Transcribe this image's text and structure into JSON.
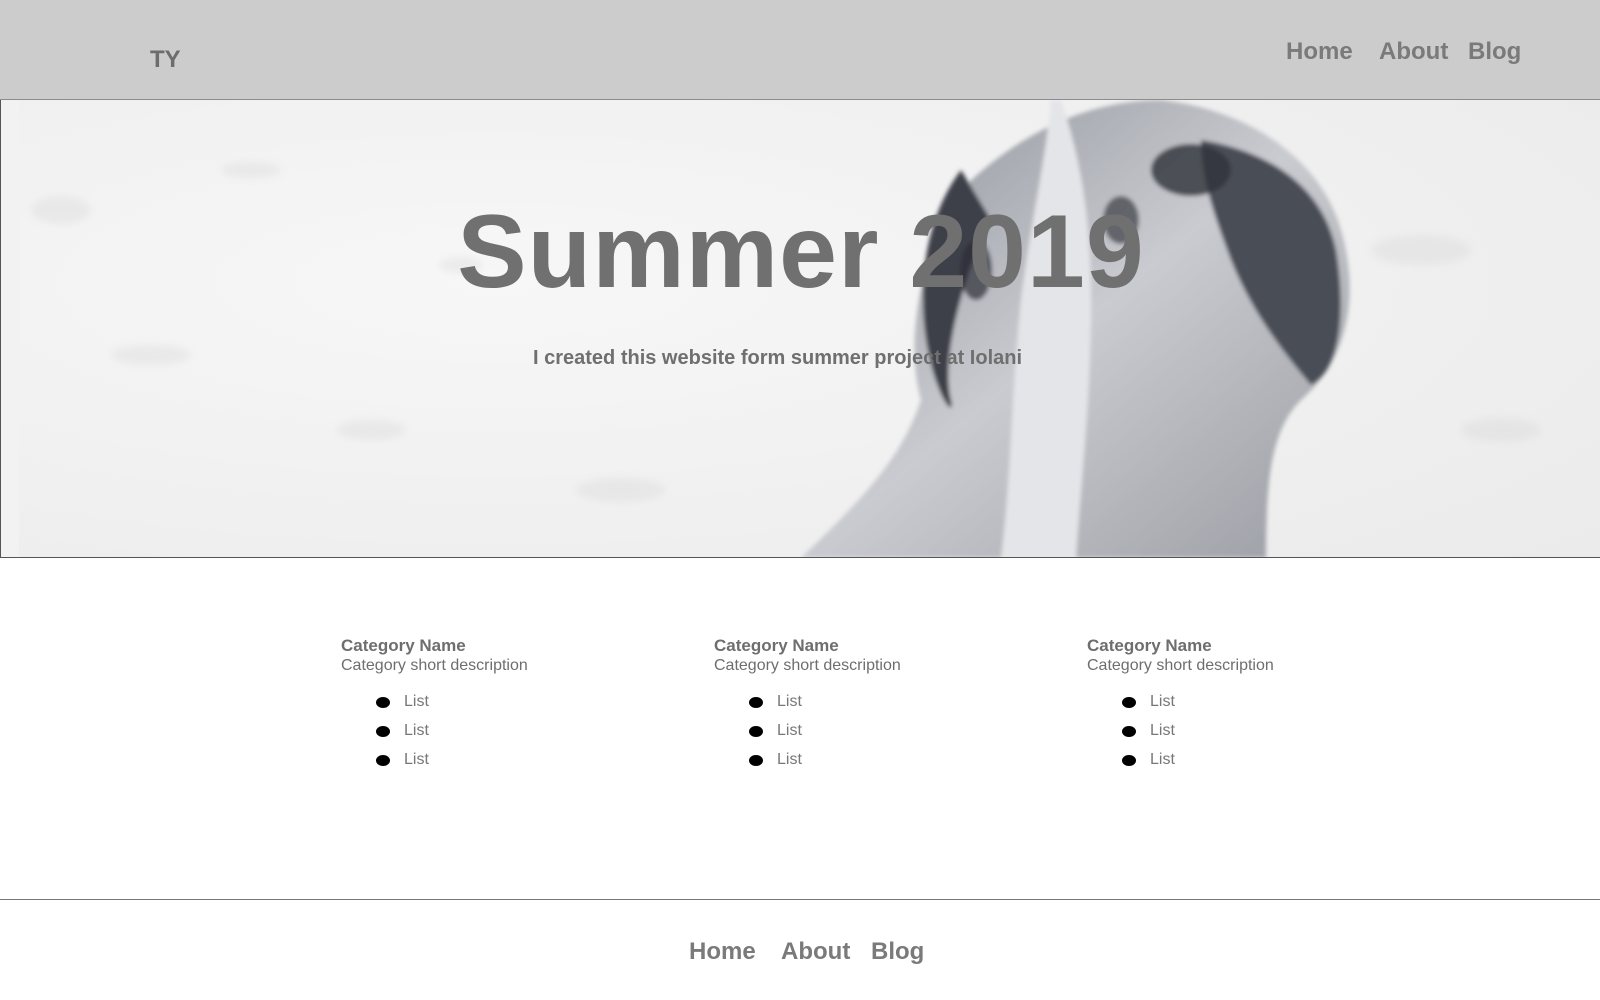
{
  "header": {
    "logo": "TY",
    "nav": [
      "Home",
      "About",
      "Blog"
    ]
  },
  "hero": {
    "title": "Summer 2019",
    "subtitle": "I created this website form summer project at Iolani"
  },
  "categories": [
    {
      "name": "Category Name",
      "description": "Category short description",
      "items": [
        "List",
        "List",
        "List"
      ]
    },
    {
      "name": "Category Name",
      "description": "Category short description",
      "items": [
        "List",
        "List",
        "List"
      ]
    },
    {
      "name": "Category Name",
      "description": "Category short description",
      "items": [
        "List",
        "List",
        "List"
      ]
    }
  ],
  "footer": {
    "nav": [
      "Home",
      "About",
      "Blog"
    ]
  },
  "colors": {
    "header_bg": "#cccccc",
    "text": "#757575",
    "bullet": "#000000"
  }
}
